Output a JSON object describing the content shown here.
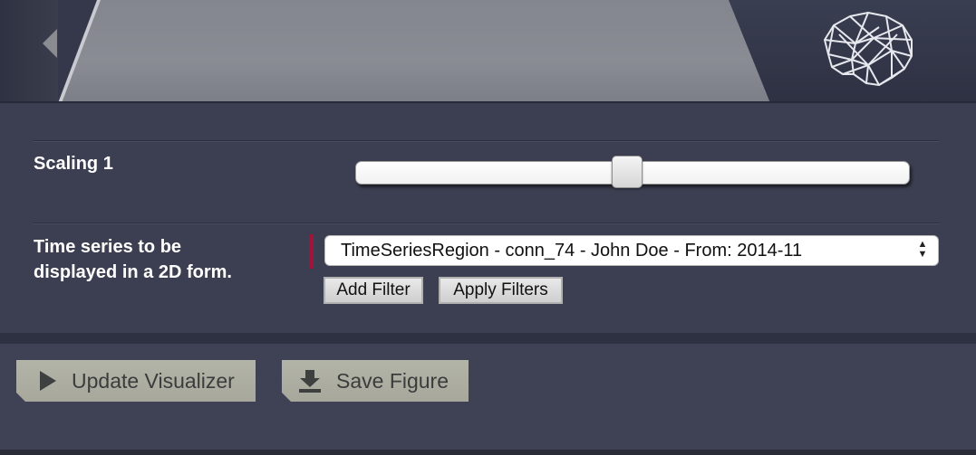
{
  "header": {
    "logo_icon": "brain-wireframe-icon",
    "collapse_icon": "collapse-left-arrow-icon"
  },
  "form": {
    "scaling": {
      "label": "Scaling 1",
      "slider_value_fraction": 0.49
    },
    "time_series": {
      "label_line1": "Time series to be",
      "label_line2": "displayed in a 2D form.",
      "selected": "TimeSeriesRegion - conn_74 - John Doe - From: 2014-11",
      "required_marker_color": "#a3143a"
    },
    "add_filter_label": "Add Filter",
    "apply_filters_label": "Apply Filters"
  },
  "actions": {
    "update_label": "Update Visualizer",
    "update_icon": "play-icon",
    "save_label": "Save Figure",
    "save_icon": "download-icon"
  },
  "colors": {
    "panel_bg": "#3c3f51",
    "button_bg": "#b3b4a8"
  }
}
